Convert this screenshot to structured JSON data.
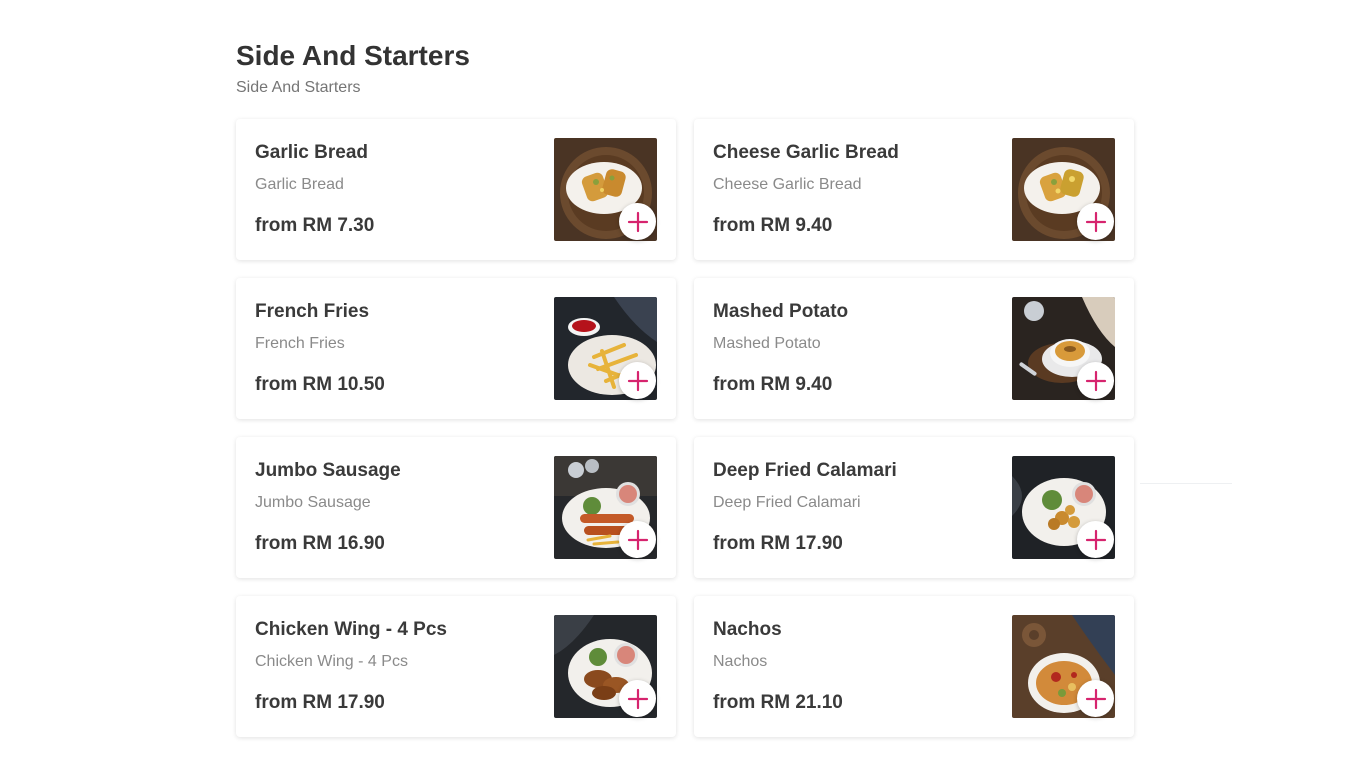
{
  "section": {
    "title": "Side And Starters",
    "subtitle": "Side And Starters"
  },
  "accent_color": "#d6246e",
  "items": [
    {
      "name": "Garlic Bread",
      "description": "Garlic Bread",
      "price": "from RM 7.30",
      "photo": "garlic-bread"
    },
    {
      "name": "Cheese Garlic Bread",
      "description": "Cheese Garlic Bread",
      "price": "from RM 9.40",
      "photo": "garlic-bread"
    },
    {
      "name": "French Fries",
      "description": "French Fries",
      "price": "from RM 10.50",
      "photo": "fries"
    },
    {
      "name": "Mashed Potato",
      "description": "Mashed Potato",
      "price": "from RM 9.40",
      "photo": "mashed"
    },
    {
      "name": "Jumbo Sausage",
      "description": "Jumbo Sausage",
      "price": "from RM 16.90",
      "photo": "sausage"
    },
    {
      "name": "Deep Fried Calamari",
      "description": "Deep Fried Calamari",
      "price": "from RM 17.90",
      "photo": "calamari"
    },
    {
      "name": "Chicken Wing - 4 Pcs",
      "description": "Chicken Wing - 4 Pcs",
      "price": "from RM 17.90",
      "photo": "wings"
    },
    {
      "name": "Nachos",
      "description": "Nachos",
      "price": "from RM 21.10",
      "photo": "nachos"
    }
  ]
}
